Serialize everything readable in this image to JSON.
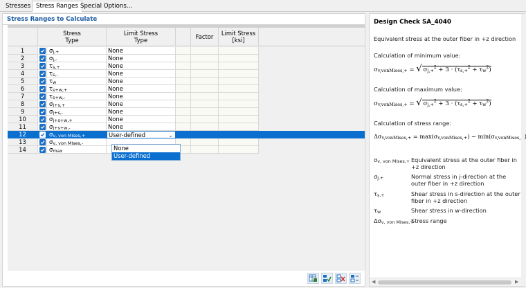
{
  "tabs": [
    {
      "label": "Stresses",
      "active": false
    },
    {
      "label": "Stress Ranges",
      "active": true
    },
    {
      "label": "Special Options...",
      "active": false
    }
  ],
  "section_title": "Stress Ranges to Calculate",
  "columns": {
    "stress_type": [
      "Stress",
      "Type"
    ],
    "limit_type": [
      "Limit Stress",
      "Type"
    ],
    "factor": "Factor",
    "limit_stress": [
      "Limit Stress",
      "[ksi]"
    ]
  },
  "rows": [
    {
      "n": "1",
      "sym": "σ",
      "sub": "j,+",
      "limit": "None",
      "checked": true
    },
    {
      "n": "2",
      "sym": "σ",
      "sub": "j,-",
      "limit": "None",
      "checked": true
    },
    {
      "n": "3",
      "sym": "τ",
      "sub": "s,+",
      "limit": "None",
      "checked": true
    },
    {
      "n": "4",
      "sym": "τ",
      "sub": "s,-",
      "limit": "None",
      "checked": true
    },
    {
      "n": "5",
      "sym": "τ",
      "sub": "w",
      "limit": "None",
      "checked": true
    },
    {
      "n": "6",
      "sym": "τ",
      "sub": "s+w,+",
      "limit": "None",
      "checked": true
    },
    {
      "n": "7",
      "sym": "τ",
      "sub": "s+w,-",
      "limit": "None",
      "checked": true
    },
    {
      "n": "8",
      "sym": "σ",
      "sub": "j+s,+",
      "limit": "None",
      "checked": true
    },
    {
      "n": "9",
      "sym": "σ",
      "sub": "j+s,-",
      "limit": "None",
      "checked": true
    },
    {
      "n": "10",
      "sym": "σ",
      "sub": "j+s+w,+",
      "limit": "None",
      "checked": true
    },
    {
      "n": "11",
      "sym": "σ",
      "sub": "j+s+w,-",
      "limit": "None",
      "checked": true
    },
    {
      "n": "12",
      "sym": "σ",
      "sub": "v, von Mises,+",
      "limit": "User-defined",
      "checked": true,
      "selected": true
    },
    {
      "n": "13",
      "sym": "σ",
      "sub": "v, von Mises,-",
      "limit": "",
      "checked": true
    },
    {
      "n": "14",
      "sym": "σ",
      "sub": "max",
      "limit": "",
      "checked": true
    }
  ],
  "dropdown_options": [
    "None",
    "User-defined"
  ],
  "dropdown_highlighted": "User-defined",
  "toolbar_icons": [
    "table-export-icon",
    "check-all-icon",
    "uncheck-all-icon",
    "toggle-check-icon"
  ],
  "right": {
    "title": "Design Check SA_4040",
    "description": "Equivalent stress at the outer fiber in +z direction",
    "min_label": "Calculation of minimum value:",
    "max_label": "Calculation of maximum value:",
    "range_label": "Calculation of stress range:",
    "legend": [
      {
        "sym": "σ",
        "sub": "v, von Mises,+",
        "desc": "Equivalent stress at the outer fiber in +z direction"
      },
      {
        "sym": "σ",
        "sub": "j,+",
        "desc": "Normal stress in j-direction at the outer fiber in +z direction"
      },
      {
        "sym": "τ",
        "sub": "s,+",
        "desc": "Shear stress in s-direction at the outer fiber in +z direction"
      },
      {
        "sym": "τ",
        "sub": "w",
        "desc": "Shear stress in w-direction"
      },
      {
        "sym": "Δσ",
        "sub": "v, von Mises,+",
        "desc": "Stress range"
      }
    ]
  },
  "colors": {
    "accent": "#0b6fcf",
    "title": "#1a5aa0",
    "checkbox": "#1a6fc4"
  }
}
